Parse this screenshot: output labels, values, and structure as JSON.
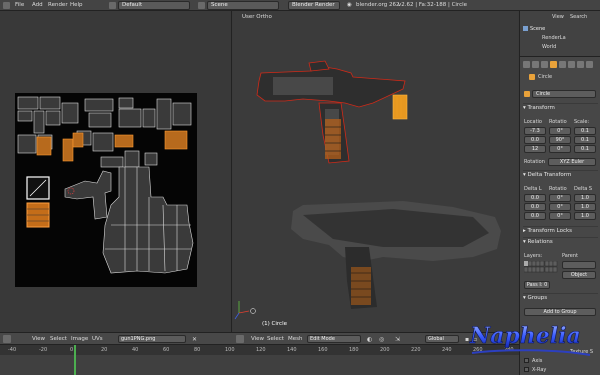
{
  "topbar": {
    "menus": [
      "File",
      "Add",
      "Render",
      "Help"
    ],
    "layout": "Default",
    "scene": "Scene",
    "engine": "Blender Render",
    "version_info": "v2.62 | Fa:32-188 | Circle",
    "blend_file": "blender.org 262"
  },
  "uv_editor": {
    "header": {
      "view": "View",
      "select": "Select",
      "image": "Image",
      "uvs": "UVs",
      "image_name": "gun1PNG.png"
    }
  },
  "view3d": {
    "title": "User Ortho",
    "object_label": "(1) Circle",
    "header": {
      "view": "View",
      "select": "Select",
      "mesh": "Mesh",
      "mode": "Edit Mode",
      "orientation": "Global"
    }
  },
  "outliner": {
    "header": {
      "view": "View",
      "search": "Search"
    },
    "items": [
      "Scene",
      "RenderLa",
      "World"
    ]
  },
  "properties": {
    "object_name": "Circle",
    "breadcrumb": "Circle",
    "transform": {
      "title": "Transform",
      "location_label": "Locatio",
      "rotation_label": "Rotatio",
      "scale_label": "Scale:",
      "location": [
        "-7.3",
        "0.0",
        "12"
      ],
      "rotation": [
        "0°",
        "90°",
        "0°"
      ],
      "scale": [
        "0.1",
        "0.1",
        "0.1"
      ],
      "rotation_mode_label": "Rotation",
      "rotation_mode": "XYZ Euler"
    },
    "delta_transform": {
      "title": "Delta Transform",
      "location_label": "Delta L",
      "rotation_label": "Rotatio",
      "scale_label": "Delta S",
      "location": [
        "0.0",
        "0.0",
        "0.0"
      ],
      "rotation": [
        "0°",
        "0°",
        "0°"
      ],
      "scale": [
        "1.0",
        "1.0",
        "1.0"
      ]
    },
    "transform_locks": {
      "title": "Transform Locks"
    },
    "relations": {
      "title": "Relations",
      "layers_label": "Layers:",
      "parent_label": "Parent",
      "parent_type": "Object",
      "pass_index": "Pass I: 0"
    },
    "groups": {
      "title": "Groups",
      "add_button": "Add to Group"
    },
    "display": {
      "texture_label": "Texture S",
      "axis_label": "Axis",
      "xray_label": "X-Ray"
    }
  },
  "timeline": {
    "ticks": [
      "-40",
      "-20",
      "0",
      "20",
      "40",
      "60",
      "80",
      "100",
      "120",
      "140",
      "160",
      "180",
      "200",
      "220",
      "240",
      "260",
      "280"
    ]
  },
  "watermark": {
    "text": "Naphelia"
  },
  "colors": {
    "header_bg": "#484848",
    "viewport_bg": "#3b3b3b",
    "uv_canvas_bg": "#050505",
    "selection_orange": "#ff8a1c",
    "edit_wire_red": "#cc2a18",
    "watermark_blue": "#3b5dff"
  }
}
